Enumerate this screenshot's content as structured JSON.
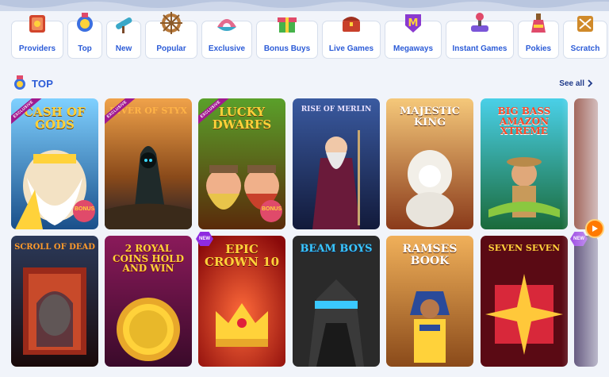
{
  "categories": [
    {
      "label": "Providers",
      "icon": "book-icon",
      "color": "#d2452c"
    },
    {
      "label": "Top",
      "icon": "medal-icon",
      "color": "#3b6fe0"
    },
    {
      "label": "New",
      "icon": "telescope-icon",
      "color": "#3aa8c8"
    },
    {
      "label": "Popular",
      "icon": "ship-wheel-icon",
      "color": "#b8793a"
    },
    {
      "label": "Exclusive",
      "icon": "pearl-shell-icon",
      "color": "#e36a8d"
    },
    {
      "label": "Bonus Buys",
      "icon": "gift-box-icon",
      "color": "#45b24a"
    },
    {
      "label": "Live Games",
      "icon": "treasure-chest-icon",
      "color": "#c8402b"
    },
    {
      "label": "Megaways",
      "icon": "m-shield-icon",
      "color": "#8a3ad0"
    },
    {
      "label": "Instant Games",
      "icon": "joystick-icon",
      "color": "#7a55d8"
    },
    {
      "label": "Pokies",
      "icon": "potion-icon",
      "color": "#e04a6a"
    },
    {
      "label": "Scratch",
      "icon": "scratch-card-icon",
      "color": "#d08a2a"
    }
  ],
  "section": {
    "title": "TOP",
    "see_all": "See all"
  },
  "games": [
    {
      "title": "CASH OF GODS",
      "badge": "exclusive",
      "bonus": "BONUS",
      "bg1": "#2a9fd6",
      "bg2": "#1a4f8a",
      "title_color": "#ffd23a"
    },
    {
      "title": "RIVER OF STYX",
      "badge": "exclusive",
      "bonus": "",
      "bg1": "#d47a1e",
      "bg2": "#2b2a3a",
      "title_color": "#ffb347"
    },
    {
      "title": "LUCKY DWARFS",
      "badge": "exclusive",
      "bonus": "BONUS",
      "bg1": "#3a7a2a",
      "bg2": "#6b3a1a",
      "title_color": "#ffd23a"
    },
    {
      "title": "RISE OF MERLIN",
      "badge": "",
      "bonus": "",
      "bg1": "#2a3f7a",
      "bg2": "#121a3a",
      "title_color": "#e9e1ff"
    },
    {
      "title": "MAJESTIC KING",
      "badge": "",
      "bonus": "",
      "bg1": "#e8a24a",
      "bg2": "#7a3a1a",
      "title_color": "#ffffff"
    },
    {
      "title": "BIG BASS AMAZON XTREME",
      "badge": "",
      "bonus": "",
      "bg1": "#2bb0c8",
      "bg2": "#1a6a3a",
      "title_color": "#ff4a2a"
    },
    {
      "title": "SCROLL OF DEAD",
      "badge": "",
      "bonus": "",
      "bg1": "#2b3a5a",
      "bg2": "#7a1a1a",
      "title_color": "#ff9a2a"
    },
    {
      "title": "2 ROYAL COINS HOLD AND WIN",
      "badge": "",
      "bonus": "",
      "bg1": "#7a1a4a",
      "bg2": "#3a0a2a",
      "title_color": "#ffd23a"
    },
    {
      "title": "EPIC CROWN 10",
      "badge": "new",
      "bonus": "",
      "bg1": "#d42a1a",
      "bg2": "#7a0a0a",
      "title_color": "#ffd23a"
    },
    {
      "title": "BEAM BOYS",
      "badge": "",
      "bonus": "",
      "bg1": "#4a4a4a",
      "bg2": "#1a1a1a",
      "title_color": "#3ac8ff"
    },
    {
      "title": "RAMSES BOOK",
      "badge": "",
      "bonus": "",
      "bg1": "#e89a3a",
      "bg2": "#8a4a1a",
      "title_color": "#ffffff"
    },
    {
      "title": "SEVEN SEVEN",
      "badge": "",
      "bonus": "",
      "bg1": "#7a0a1a",
      "bg2": "#3a0008",
      "title_color": "#ffd23a"
    }
  ],
  "badges": {
    "exclusive": "EXCLUSIVE",
    "new": "NEW"
  }
}
